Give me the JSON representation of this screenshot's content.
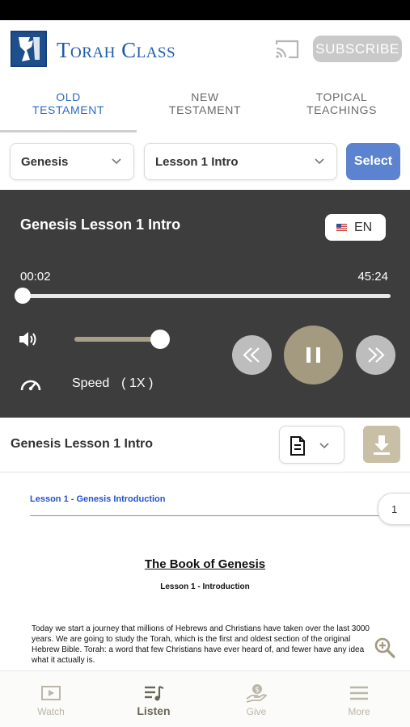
{
  "app": {
    "name": "Torah Class",
    "subscribe_label": "SUBSCRIBE"
  },
  "tabs": [
    {
      "line1": "OLD",
      "line2": "TESTAMENT",
      "active": true
    },
    {
      "line1": "NEW",
      "line2": "TESTAMENT",
      "active": false
    },
    {
      "line1": "TOPICAL",
      "line2": "TEACHINGS",
      "active": false
    }
  ],
  "selectors": {
    "book": "Genesis",
    "lesson": "Lesson 1 Intro",
    "select_label": "Select"
  },
  "player": {
    "title": "Genesis Lesson 1 Intro",
    "language": "EN",
    "current_time": "00:02",
    "total_time": "45:24",
    "progress_fraction": 0.001,
    "volume_fraction": 1.0,
    "speed_label": "Speed",
    "speed_value": "( 1X )"
  },
  "lesson_bar": {
    "title": "Genesis Lesson 1 Intro"
  },
  "document": {
    "header": "Lesson 1 - Genesis Introduction",
    "page_number": "1",
    "title": "The Book of Genesis",
    "subtitle": "Lesson 1 - Introduction",
    "body": " Today we start a journey that millions of Hebrews and Christians have taken over the last 3000 years. We are going to study the Torah, which is the first and oldest section of the original Hebrew Bible. Torah: a word that few Christians have ever heard of, and fewer have any idea what it actually is."
  },
  "bottom_nav": [
    {
      "label": "Watch",
      "icon": "play-icon",
      "active": false
    },
    {
      "label": "Listen",
      "icon": "playlist-icon",
      "active": true
    },
    {
      "label": "Give",
      "icon": "donate-icon",
      "active": false
    },
    {
      "label": "More",
      "icon": "menu-icon",
      "active": false
    }
  ],
  "colors": {
    "brand_blue": "#1f5aa6",
    "select_button": "#5c83cf",
    "player_bg": "#3d3d3d",
    "accent_gold": "#a39a80"
  }
}
